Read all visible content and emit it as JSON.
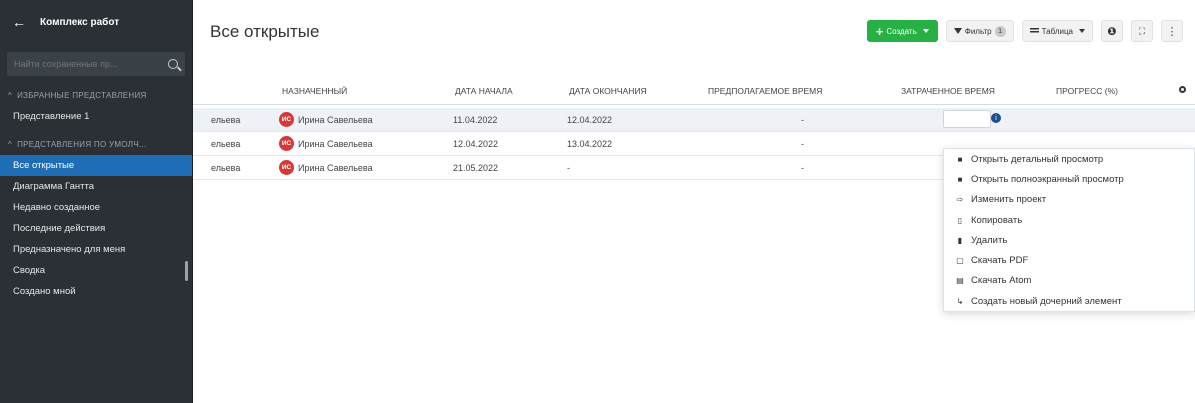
{
  "sidebar": {
    "back_icon": "arrow-left-icon",
    "title": "Комплекс работ",
    "search_placeholder": "Найти сохраненные пр...",
    "sections": [
      {
        "label": "ИЗБРАННЫЕ ПРЕДСТАВЛЕНИЯ",
        "items": [
          "Представление 1"
        ]
      },
      {
        "label": "ПРЕДСТАВЛЕНИЯ ПО УМОЛЧ...",
        "items": [
          "Все открытые",
          "Диаграмма Гантта",
          "Недавно созданное",
          "Последние действия",
          "Предназначено для меня",
          "Сводка",
          "Создано мной"
        ]
      }
    ],
    "active_item": "Все открытые"
  },
  "header": {
    "title": "Все открытые",
    "create_label": "Создать",
    "filter_label": "Фильтр",
    "filter_count": "1",
    "view_label": "Таблица"
  },
  "table": {
    "columns": [
      "НАЗНАЧЕННЫЙ",
      "ДАТА НАЧАЛА",
      "ДАТА ОКОНЧАНИЯ",
      "ПРЕДПОЛАГАЕМОЕ ВРЕМЯ",
      "ЗАТРАЧЕННОЕ ВРЕМЯ",
      "ПРОГРЕСС (%)"
    ],
    "rows": [
      {
        "partial": "ельева",
        "initials": "ИС",
        "assignee": "Ирина Савельева",
        "start": "11.04.2022",
        "end": "12.04.2022",
        "estimated": "-",
        "spent": ""
      },
      {
        "partial": "ельева",
        "initials": "ИС",
        "assignee": "Ирина Савельева",
        "start": "12.04.2022",
        "end": "13.04.2022",
        "estimated": "-",
        "spent": ""
      },
      {
        "partial": "ельева",
        "initials": "ИС",
        "assignee": "Ирина Савельева",
        "start": "21.05.2022",
        "end": "-",
        "estimated": "-",
        "spent": ""
      }
    ]
  },
  "context_menu": {
    "items": [
      {
        "icon": "■",
        "label": "Открыть детальный просмотр"
      },
      {
        "icon": "■",
        "label": "Открыть полноэкранный просмотр"
      },
      {
        "icon": "⇨",
        "label": "Изменить проект"
      },
      {
        "icon": "▯",
        "label": "Копировать"
      },
      {
        "icon": "▮",
        "label": "Удалить"
      },
      {
        "icon": "▢",
        "label": "Скачать PDF"
      },
      {
        "icon": "▤",
        "label": "Скачать Atom"
      },
      {
        "icon": "↳",
        "label": "Создать новый дочерний элемент"
      }
    ]
  },
  "colors": {
    "sidebar_bg": "#2a3036",
    "active_item": "#1f6db5",
    "create_button": "#27b044",
    "avatar": "#d6393a"
  }
}
